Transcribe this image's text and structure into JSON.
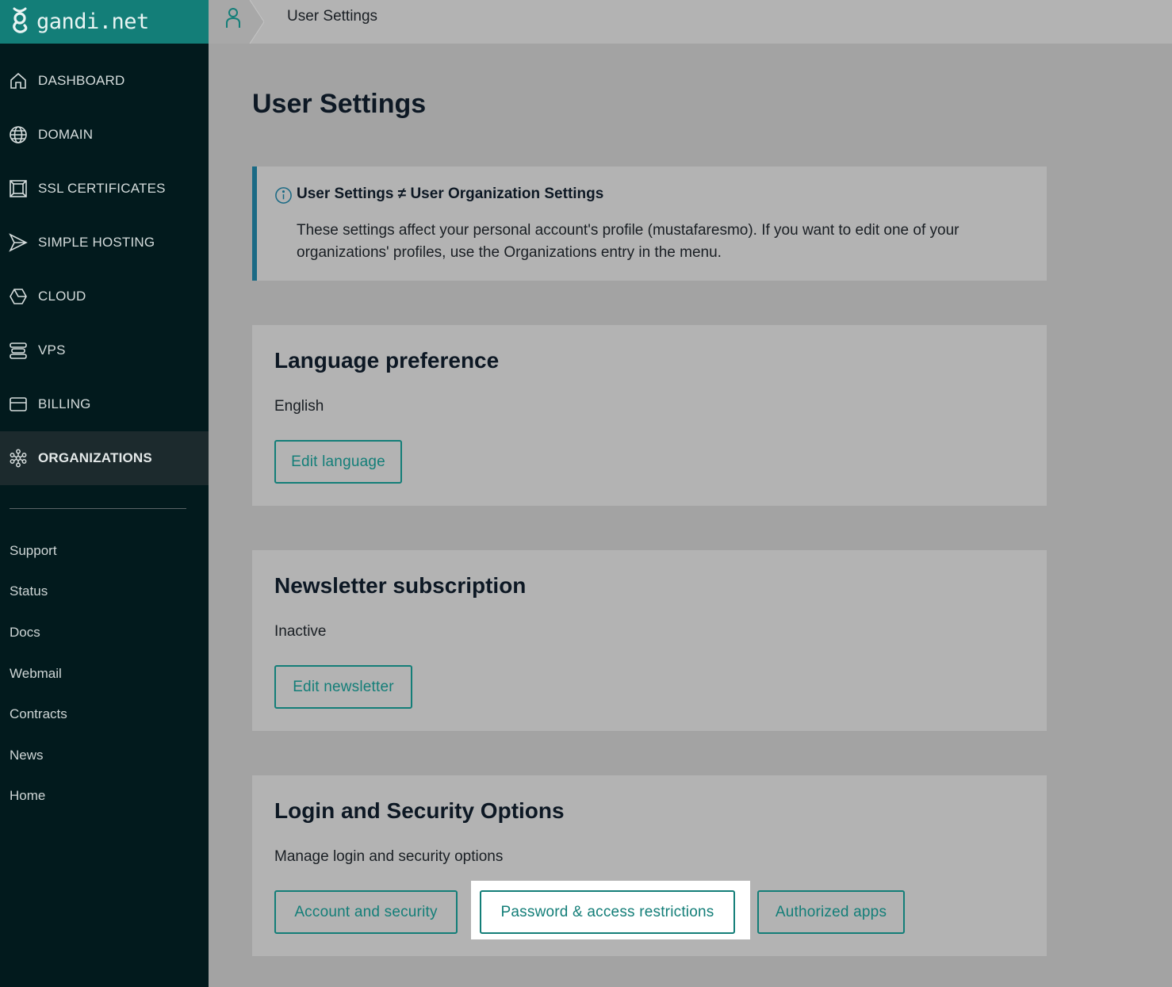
{
  "brand": {
    "name": "gandi.net"
  },
  "header": {
    "title": "User Settings"
  },
  "sidebar": {
    "items": [
      {
        "label": "DASHBOARD",
        "icon": "home-icon"
      },
      {
        "label": "DOMAIN",
        "icon": "globe-icon"
      },
      {
        "label": "SSL CERTIFICATES",
        "icon": "certificate-icon"
      },
      {
        "label": "SIMPLE HOSTING",
        "icon": "send-icon"
      },
      {
        "label": "CLOUD",
        "icon": "cloud-hexagon-icon"
      },
      {
        "label": "VPS",
        "icon": "server-icon"
      },
      {
        "label": "BILLING",
        "icon": "credit-card-icon"
      },
      {
        "label": "ORGANIZATIONS",
        "icon": "organizations-icon",
        "active": true
      }
    ],
    "links": [
      "Support",
      "Status",
      "Docs",
      "Webmail",
      "Contracts",
      "News",
      "Home"
    ]
  },
  "main": {
    "title": "User Settings",
    "notice": {
      "title": "User Settings ≠ User Organization Settings",
      "body": "These settings affect your personal account's profile (mustafaresmo). If you want to edit one of your organizations' profiles, use the Organizations entry in the menu."
    },
    "language": {
      "title": "Language preference",
      "value": "English",
      "button": "Edit language"
    },
    "newsletter": {
      "title": "Newsletter subscription",
      "value": "Inactive",
      "button": "Edit newsletter"
    },
    "security": {
      "title": "Login and Security Options",
      "value": "Manage login and security options",
      "buttons": [
        "Account and security",
        "Password & access restrictions",
        "Authorized apps"
      ]
    }
  },
  "colors": {
    "brand": "#137e78",
    "sidebar": "#021a1d",
    "notice_border": "#1a6a85"
  }
}
